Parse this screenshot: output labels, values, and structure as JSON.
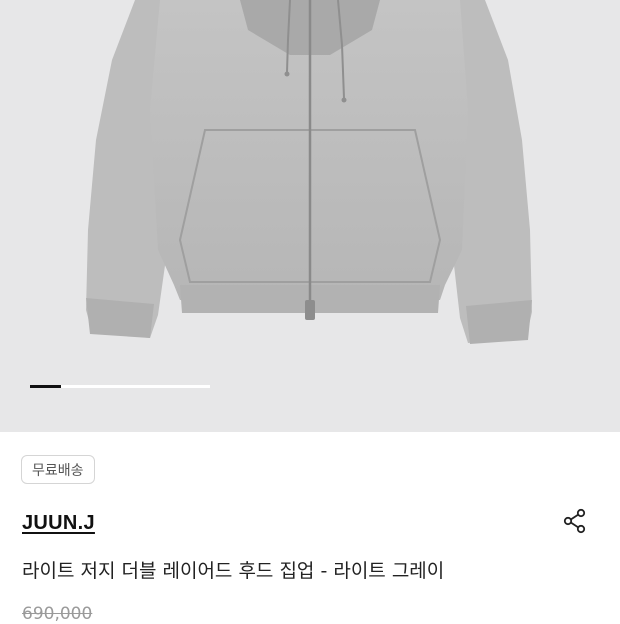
{
  "product_image": {
    "description_icon": "hoodie-image",
    "carousel_progress": 0.17,
    "carousel_track_color": "#ffffff",
    "carousel_fill_color": "#111111",
    "background_color": "#e7e7e8"
  },
  "badge": {
    "label": "무료배송"
  },
  "brand": {
    "name": "JUUN.J"
  },
  "share": {
    "icon": "share-icon"
  },
  "product": {
    "title": "라이트 저지 더블 레이어드 후드 집업 - 라이트 그레이",
    "original_price": "690,000"
  }
}
